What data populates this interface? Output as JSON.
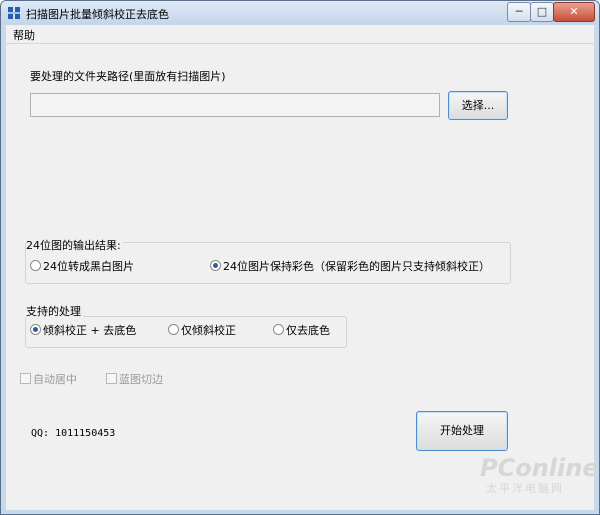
{
  "window": {
    "title": "扫描图片批量倾斜校正去底色",
    "controls": {
      "minimize": "─",
      "maximize": "□",
      "close": "✕"
    }
  },
  "menu": {
    "help": "帮助"
  },
  "folder": {
    "label": "要处理的文件夹路径(里面放有扫描图片)",
    "value": "",
    "select_button": "选择..."
  },
  "output24": {
    "legend": "24位图的输出结果:",
    "options": [
      {
        "label": "24位转成黑白图片",
        "selected": false
      },
      {
        "label": "24位图片保持彩色（保留彩色的图片只支持倾斜校正）",
        "selected": true
      }
    ]
  },
  "processing": {
    "legend": "支持的处理",
    "options": [
      {
        "label": "倾斜校正 + 去底色",
        "selected": true
      },
      {
        "label": "仅倾斜校正",
        "selected": false
      },
      {
        "label": "仅去底色",
        "selected": false
      }
    ]
  },
  "checkboxes": [
    {
      "label": "自动居中",
      "checked": false,
      "enabled": false
    },
    {
      "label": "蓝图切边",
      "checked": false,
      "enabled": false
    }
  ],
  "qq": "QQ: 1011150453",
  "start_button": "开始处理",
  "watermark": {
    "brand": "PConline",
    "sub": "太平洋电脑网"
  },
  "colors": {
    "accent": "#2f5e9a",
    "titlebar": "#c9d9ec"
  },
  "icons": {
    "app": "app-icon",
    "close": "close-icon",
    "minimize": "minimize-icon",
    "maximize": "maximize-icon"
  }
}
